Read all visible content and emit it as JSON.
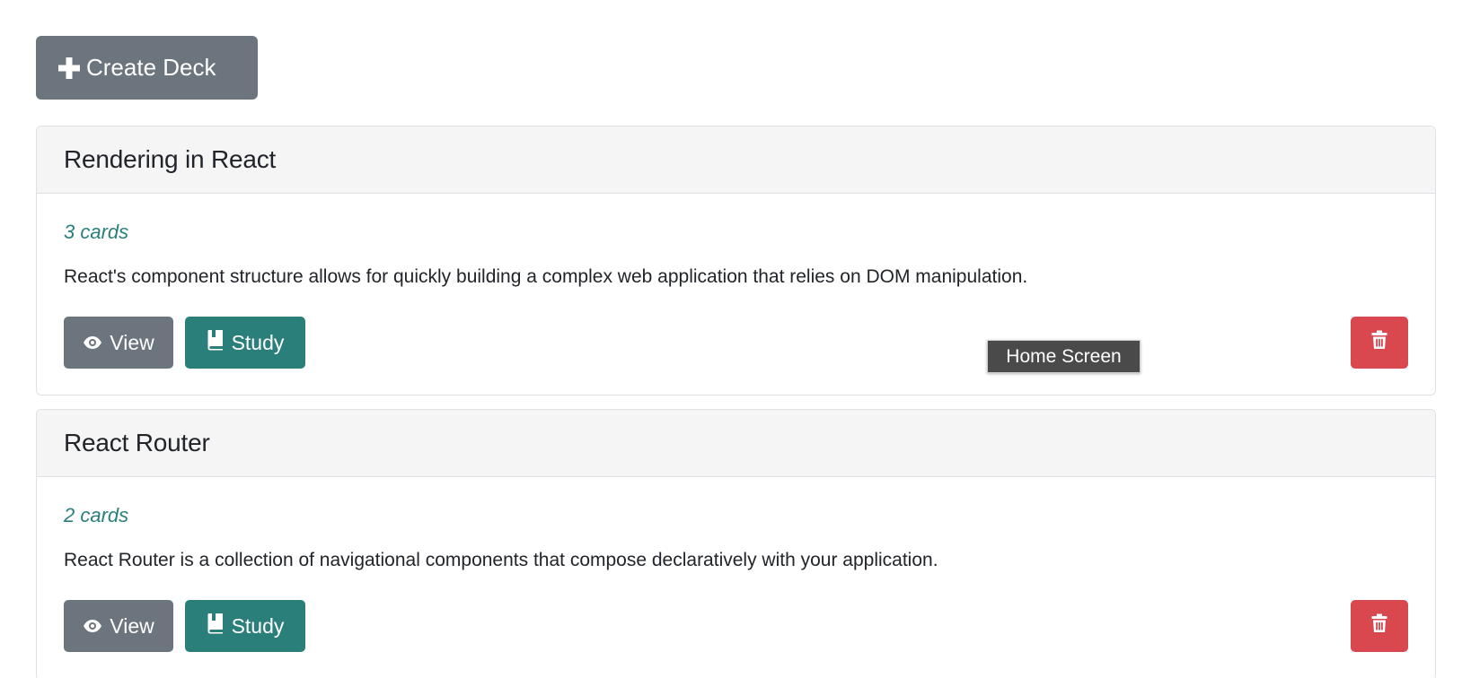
{
  "toolbar": {
    "create_label": "Create Deck"
  },
  "decks": [
    {
      "title": "Rendering in React",
      "count": "3 cards",
      "description": "React's component structure allows for quickly building a complex web application that relies on DOM manipulation.",
      "view_label": "View",
      "study_label": "Study"
    },
    {
      "title": "React Router",
      "count": "2 cards",
      "description": "React Router is a collection of navigational components that compose declaratively with your application.",
      "view_label": "View",
      "study_label": "Study"
    }
  ],
  "tooltip": {
    "text": "Home Screen"
  },
  "icons": {
    "create": "plus-icon",
    "view": "eye-icon",
    "study": "book-icon",
    "delete": "trash-icon"
  },
  "colors": {
    "secondary": "#6c757d",
    "study": "#2a7f7a",
    "danger": "#d9474f",
    "count_text": "#2a7f7a",
    "header_bg": "#f5f5f5"
  }
}
